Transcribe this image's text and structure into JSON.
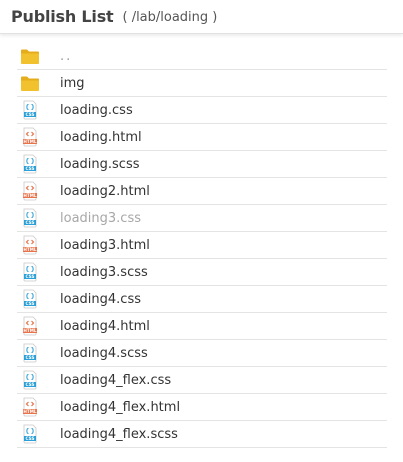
{
  "header": {
    "title": "Publish List",
    "path": "( /lab/loading )"
  },
  "colors": {
    "folder": "#f2c12e",
    "folder_tab": "#e5ad1c",
    "css_icon": "#2a9fd8",
    "html_icon": "#e8734a",
    "dim_text": "#a7a7a7"
  },
  "items": [
    {
      "name": "..",
      "icon": "folder-icon",
      "kind": "parent"
    },
    {
      "name": "img",
      "icon": "folder-icon",
      "kind": "folder"
    },
    {
      "name": "loading.css",
      "icon": "css-file-icon",
      "kind": "css"
    },
    {
      "name": "loading.html",
      "icon": "html-file-icon",
      "kind": "html"
    },
    {
      "name": "loading.scss",
      "icon": "css-file-icon",
      "kind": "css"
    },
    {
      "name": "loading2.html",
      "icon": "html-file-icon",
      "kind": "html"
    },
    {
      "name": "loading3.css",
      "icon": "css-file-icon",
      "kind": "css",
      "visited": true
    },
    {
      "name": "loading3.html",
      "icon": "html-file-icon",
      "kind": "html"
    },
    {
      "name": "loading3.scss",
      "icon": "css-file-icon",
      "kind": "css"
    },
    {
      "name": "loading4.css",
      "icon": "css-file-icon",
      "kind": "css"
    },
    {
      "name": "loading4.html",
      "icon": "html-file-icon",
      "kind": "html"
    },
    {
      "name": "loading4.scss",
      "icon": "css-file-icon",
      "kind": "css"
    },
    {
      "name": "loading4_flex.css",
      "icon": "css-file-icon",
      "kind": "css"
    },
    {
      "name": "loading4_flex.html",
      "icon": "html-file-icon",
      "kind": "html"
    },
    {
      "name": "loading4_flex.scss",
      "icon": "css-file-icon",
      "kind": "css"
    }
  ]
}
